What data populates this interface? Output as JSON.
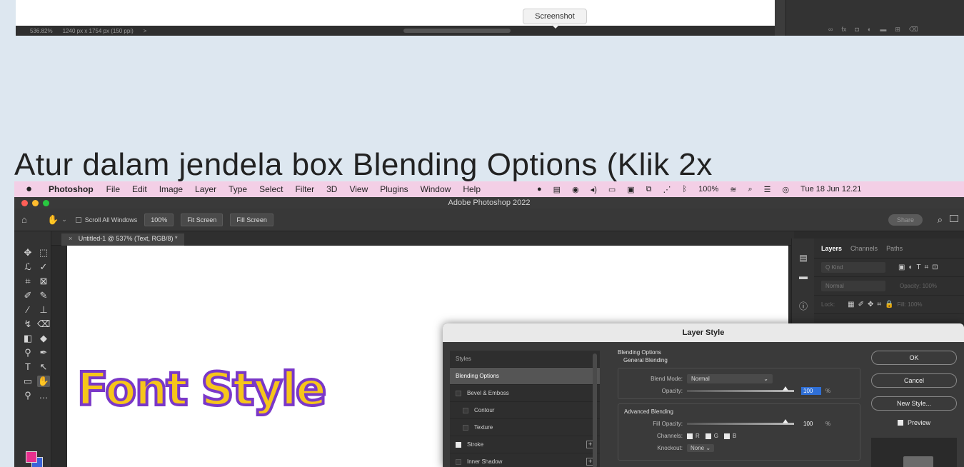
{
  "top_strip": {
    "zoom": "536.82%",
    "doc_info": "1240 px x 1754 px (150 ppi)",
    "arrow": ">",
    "tooltip": "Screenshot",
    "icons": [
      "∞",
      "fx",
      "◘",
      "◐",
      "▬",
      "⊞",
      "⌫"
    ]
  },
  "heading": "Atur dalam jendela box Blending Options (Klik 2x",
  "menubar": {
    "apple": "",
    "app": "Photoshop",
    "items": [
      "File",
      "Edit",
      "Image",
      "Layer",
      "Type",
      "Select",
      "Filter",
      "3D",
      "View",
      "Plugins",
      "Window",
      "Help"
    ],
    "battery": "100%",
    "datetime": "Tue 18 Jun 12.21"
  },
  "window": {
    "title": "Adobe Photoshop 2022"
  },
  "options_bar": {
    "scroll_all": "Scroll All Windows",
    "zoom_btn": "100%",
    "fit_screen": "Fit Screen",
    "fill_screen": "Fill Screen",
    "share": "Share"
  },
  "document": {
    "tab": "Untitled-1 @ 537% (Text, RGB/8) *",
    "art_text": "Font Style"
  },
  "layers_panel": {
    "tabs": [
      "Layers",
      "Channels",
      "Paths"
    ],
    "kind": "Q Kind",
    "mode": "Normal",
    "opacity": "Opacity: 100%",
    "lock": "Lock:",
    "fill": "Fill: 100%"
  },
  "dialog": {
    "title": "Layer Style",
    "styles": [
      {
        "label": "Styles",
        "header": true
      },
      {
        "label": "Blending Options",
        "selected": true
      },
      {
        "label": "Bevel & Emboss",
        "checked": false
      },
      {
        "label": "Contour",
        "checked": false,
        "indent": true
      },
      {
        "label": "Texture",
        "checked": false,
        "indent": true
      },
      {
        "label": "Stroke",
        "checked": true,
        "plus": true
      },
      {
        "label": "Inner Shadow",
        "checked": false,
        "plus": true
      }
    ],
    "blending": {
      "section": "Blending Options",
      "general": "General Blending",
      "blend_mode_label": "Blend Mode:",
      "blend_mode": "Normal",
      "opacity_label": "Opacity:",
      "opacity": "100",
      "pct": "%",
      "advanced": "Advanced Blending",
      "fill_opacity_label": "Fill Opacity:",
      "fill_opacity": "100",
      "channels_label": "Channels:",
      "channels": [
        "R",
        "G",
        "B"
      ],
      "knockout_label": "Knockout:",
      "knockout": "None"
    },
    "buttons": {
      "ok": "OK",
      "cancel": "Cancel",
      "new_style": "New Style...",
      "preview": "Preview"
    }
  },
  "colors": {
    "foreground": "#e8308e",
    "background": "#3a63d8",
    "menubar": "#f3cfe6",
    "page": "#dde7f0"
  }
}
